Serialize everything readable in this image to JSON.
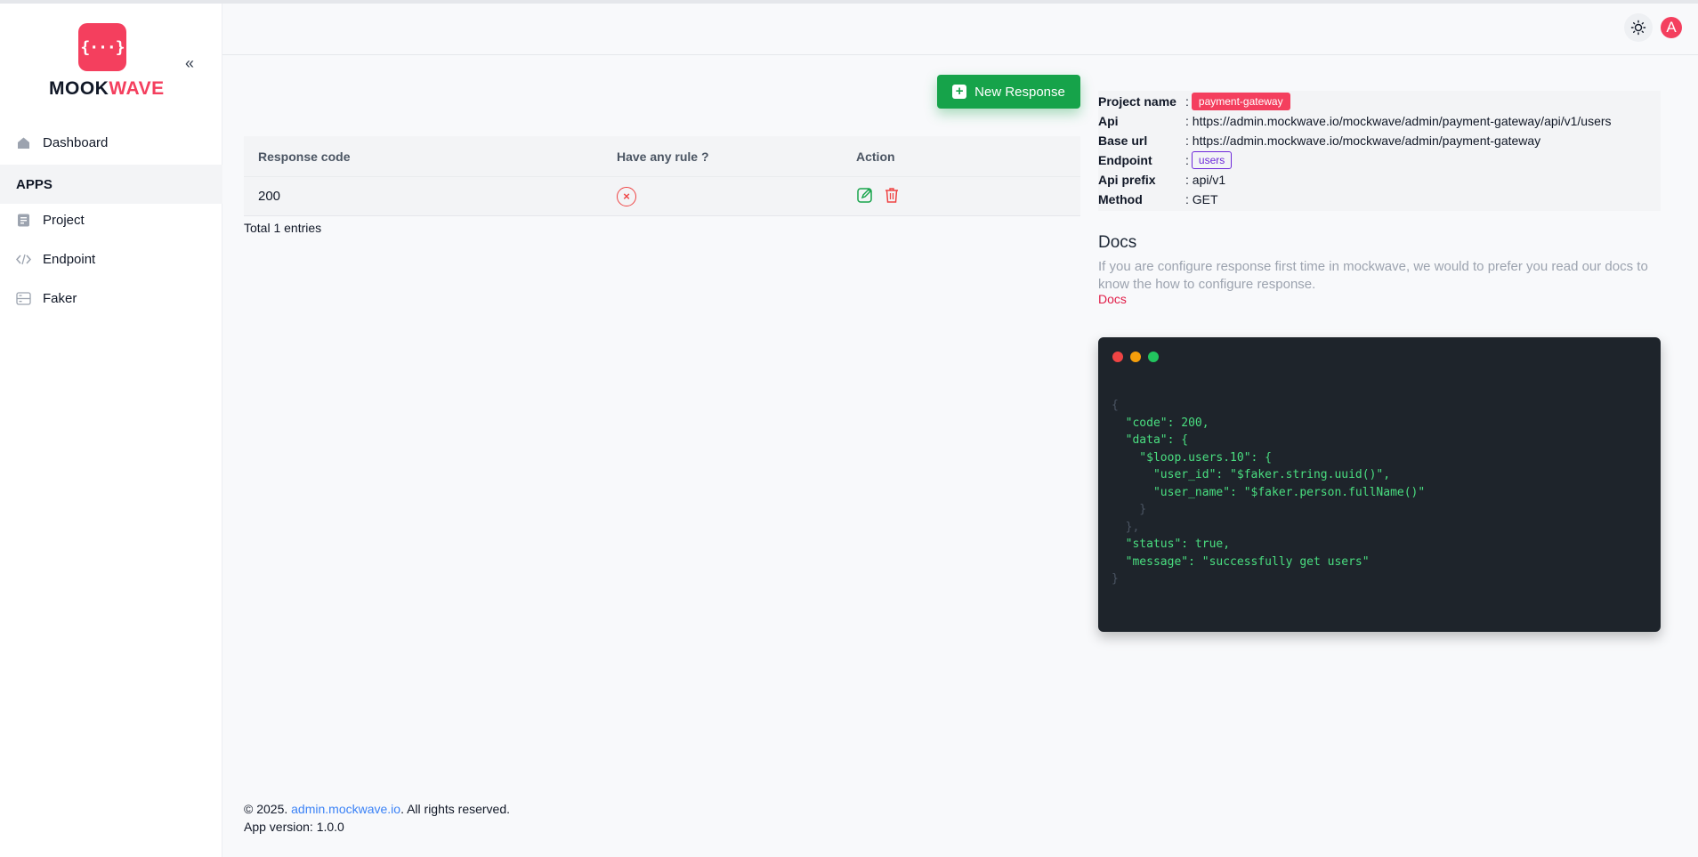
{
  "sidebar": {
    "logo_symbol": "{···}",
    "logo_text_dark": "MOOK",
    "logo_text_accent": "WAVE",
    "collapse_icon": "«",
    "dashboard": "Dashboard",
    "section": "APPS",
    "items": [
      "Project",
      "Endpoint",
      "Faker"
    ]
  },
  "header": {
    "avatar_letter": "A",
    "theme_icon": "sun-icon"
  },
  "toolbar": {
    "new_response": "New Response"
  },
  "table": {
    "headers": [
      "Response code",
      "Have any rule ?",
      "Action"
    ],
    "rows": [
      {
        "code": "200",
        "has_rule": false
      }
    ],
    "total": "Total 1 entries"
  },
  "info": {
    "project_label": "Project name",
    "project_value": "payment-gateway",
    "api_label": "Api",
    "api_value": "https://admin.mockwave.io/mockwave/admin/payment-gateway/api/v1/users",
    "base_label": "Base url",
    "base_value": "https://admin.mockwave.io/mockwave/admin/payment-gateway",
    "endpoint_label": "Endpoint",
    "endpoint_value": "users",
    "prefix_label": "Api prefix",
    "prefix_value": "api/v1",
    "method_label": "Method",
    "method_value": "GET"
  },
  "docs": {
    "title": "Docs",
    "text": "If you are configure response first time in mockwave, we would to prefer you read our docs to know the how to configure response.",
    "link": "Docs"
  },
  "code": {
    "lines": [
      "{",
      "  \"code\": 200,",
      "  \"data\": {",
      "    \"$loop.users.10\": {",
      "      \"user_id\": \"$faker.string.uuid()\",",
      "      \"user_name\": \"$faker.person.fullName()\"",
      "    }",
      "  },",
      "  \"status\": true,",
      "  \"message\": \"successfully get users\"",
      "}"
    ]
  },
  "footer": {
    "prefix": "© 2025. ",
    "link": "admin.mockwave.io",
    "suffix": ". All rights reserved.",
    "version": "App version: 1.0.0"
  },
  "colors": {
    "brand": "#f43f5e",
    "primary_button": "#16a34a",
    "code_bg": "#1e242b"
  }
}
